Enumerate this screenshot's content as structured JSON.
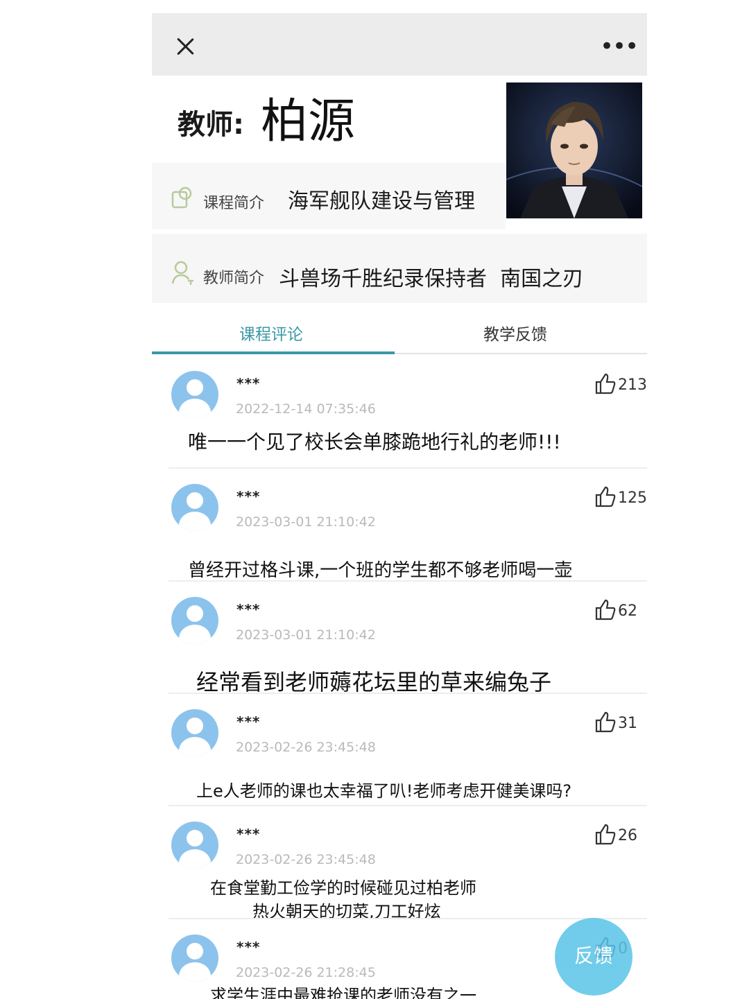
{
  "header": {
    "close_icon": "close-icon",
    "more_label": "•••"
  },
  "teacher": {
    "label": "教师:",
    "name": "柏源"
  },
  "course_intro": {
    "icon": "course-icon",
    "label": "课程简介",
    "value": "海军舰队建设与管理"
  },
  "teacher_intro": {
    "icon": "person-icon",
    "label": "教师简介",
    "value": "斗兽场千胜纪录保持者  南国之刃"
  },
  "tabs": [
    {
      "label": "课程评论",
      "active": true
    },
    {
      "label": "教学反馈",
      "active": false
    }
  ],
  "comments": [
    {
      "user": "***",
      "time": "2022-12-14 07:35:46",
      "likes": "213",
      "text": "唯一一个见了校长会单膝跪地行礼的老师!!!"
    },
    {
      "user": "***",
      "time": "2023-03-01 21:10:42",
      "likes": "125",
      "text": "曾经开过格斗课,一个班的学生都不够老师喝一壶"
    },
    {
      "user": "***",
      "time": "2023-03-01 21:10:42",
      "likes": "62",
      "text": "经常看到老师薅花坛里的草来编兔子"
    },
    {
      "user": "***",
      "time": "2023-02-26 23:45:48",
      "likes": "31",
      "text": "上e人老师的课也太幸福了叭!老师考虑开健美课吗?"
    },
    {
      "user": "***",
      "time": "2023-02-26 23:45:48",
      "likes": "26",
      "text_line1": "在食堂勤工俭学的时候碰见过柏老师",
      "text_line2": "热火朝天的切菜,刀工好炫"
    },
    {
      "user": "***",
      "time": "2023-02-26 21:28:45",
      "likes": "0",
      "text": "求学生涯中最难抢课的老师没有之一"
    }
  ],
  "feedback_button": {
    "label": "反馈"
  },
  "colors": {
    "accent": "#3b98a6",
    "avatar": "#8cc3ec",
    "fab": "#59c4e8"
  }
}
